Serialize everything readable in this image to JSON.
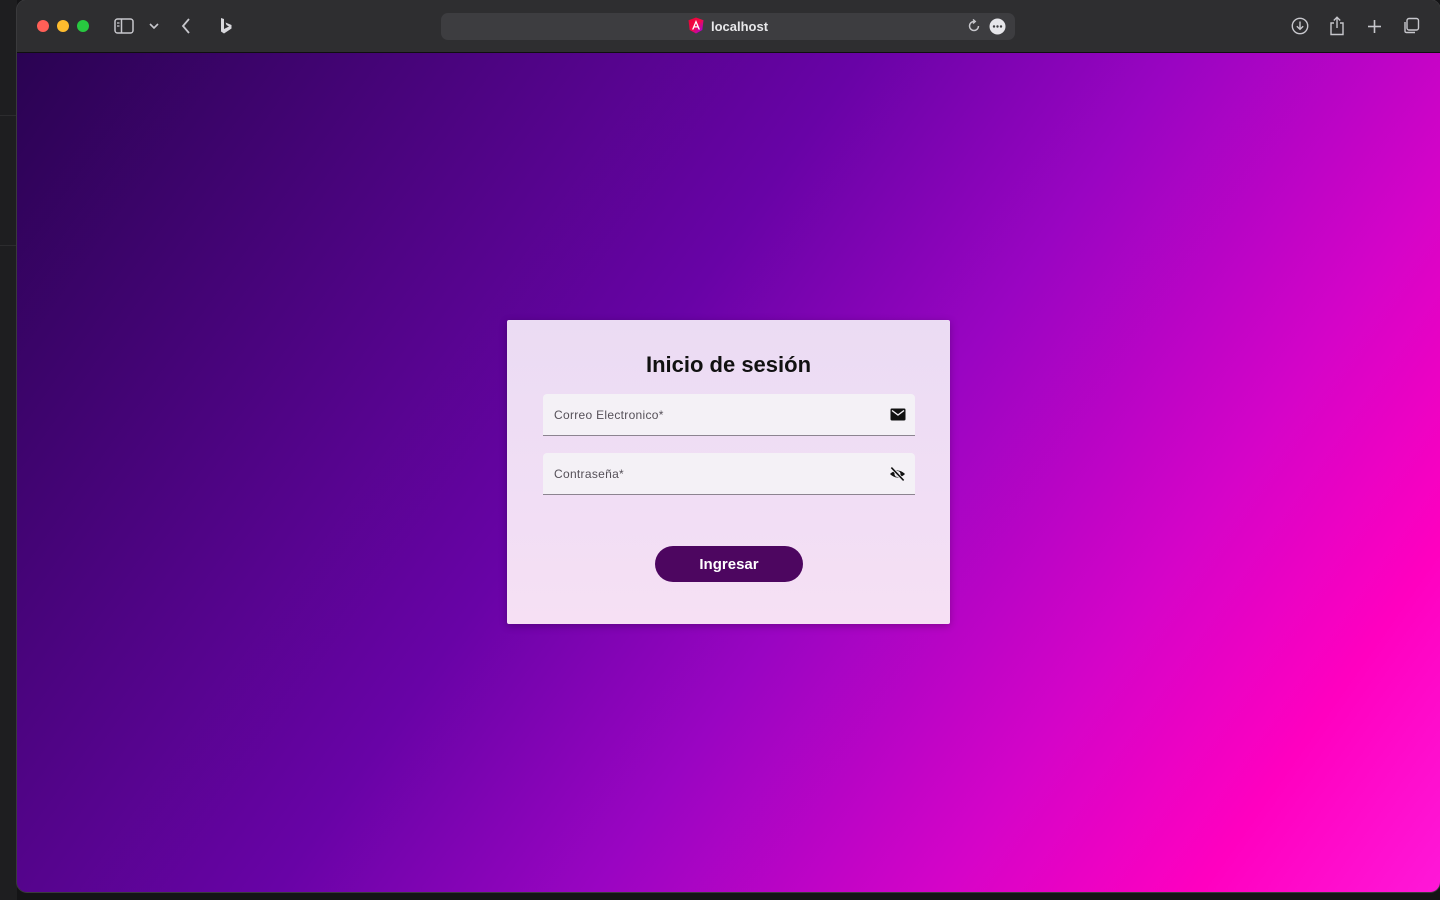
{
  "browser": {
    "address": "localhost",
    "icons": {
      "sidebar": "sidebar-icon",
      "tab_overview_dropdown": "chevron-down-icon",
      "back": "chevron-left-icon",
      "search_engine": "bing-icon",
      "site": "angular-icon",
      "reload": "reload-icon",
      "more": "more-icon",
      "downloads": "download-icon",
      "share": "share-icon",
      "new_tab": "plus-icon",
      "tabs": "tabs-icon"
    },
    "traffic_lights": {
      "close": "#ff5f57",
      "minimize": "#febc2e",
      "zoom": "#28c840"
    }
  },
  "login": {
    "title": "Inicio de sesión",
    "email": {
      "label": "Correo Electronico*",
      "icon": "mail-icon"
    },
    "password": {
      "label": "Contraseña*",
      "icon": "visibility-off-icon"
    },
    "submit_label": "Ingresar"
  },
  "colors": {
    "button": "#4d0660",
    "gradient_start": "#2a0352",
    "gradient_end": "#ff18d8"
  }
}
